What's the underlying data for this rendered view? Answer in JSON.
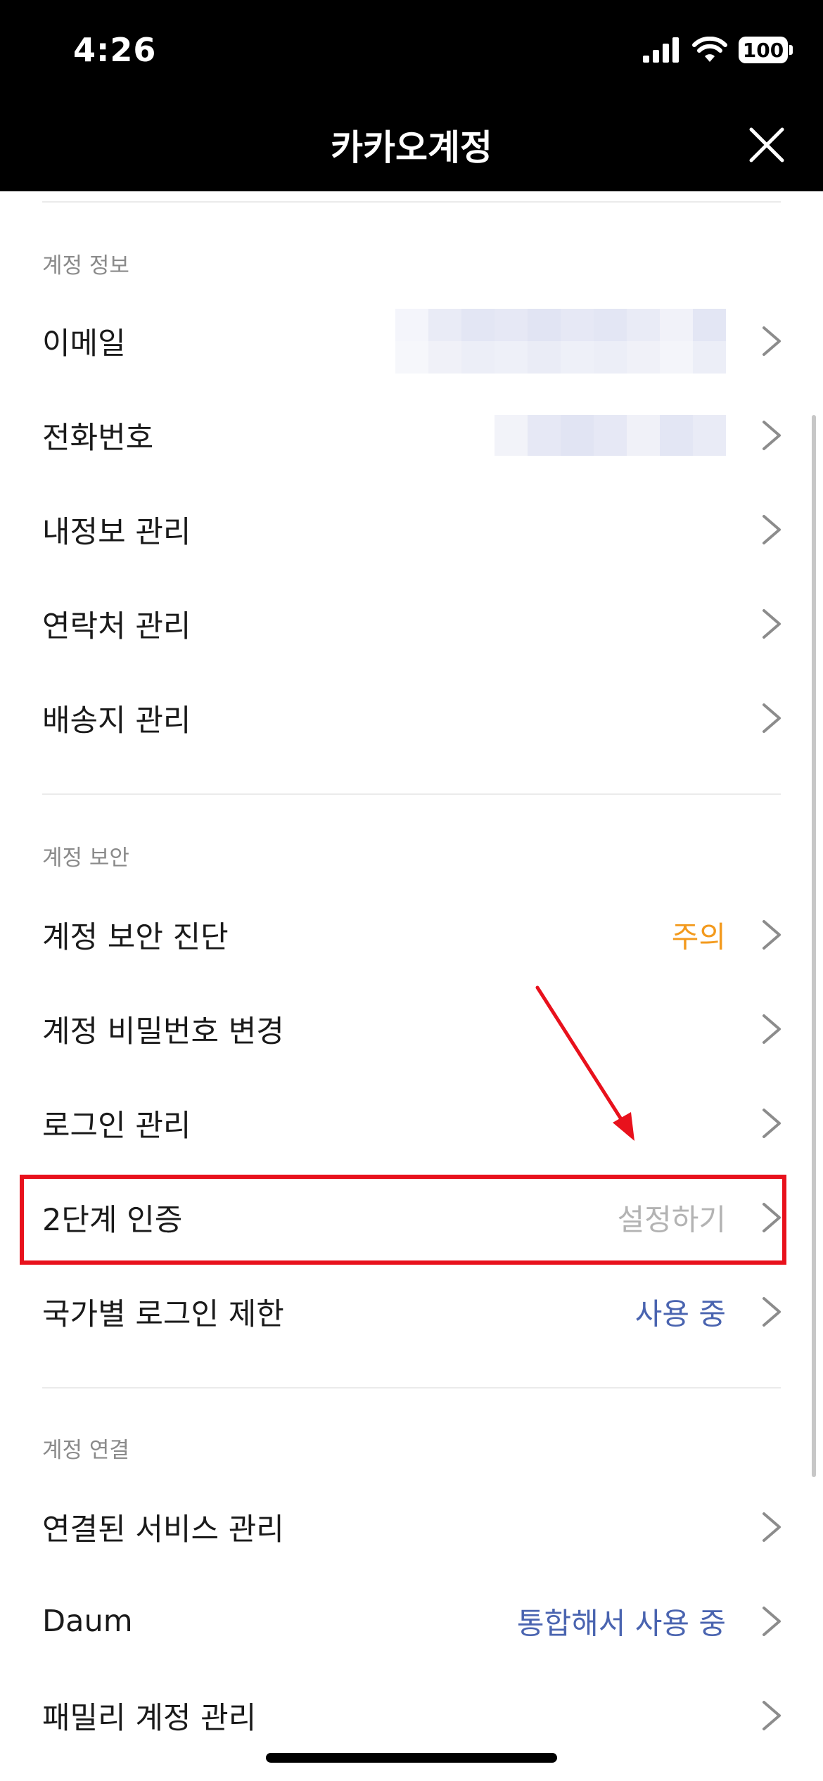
{
  "status_bar": {
    "time": "4:26",
    "battery": "100"
  },
  "header": {
    "title": "카카오계정"
  },
  "sections": [
    {
      "header": "계정 정보",
      "items": [
        {
          "label": "이메일",
          "value": "",
          "value_type": "redacted"
        },
        {
          "label": "전화번호",
          "value": "",
          "value_type": "redacted"
        },
        {
          "label": "내정보 관리",
          "value": ""
        },
        {
          "label": "연락처 관리",
          "value": ""
        },
        {
          "label": "배송지 관리",
          "value": ""
        }
      ]
    },
    {
      "header": "계정 보안",
      "items": [
        {
          "label": "계정 보안 진단",
          "value": "주의",
          "value_color": "#f39a1d"
        },
        {
          "label": "계정 비밀번호 변경",
          "value": ""
        },
        {
          "label": "로그인 관리",
          "value": ""
        },
        {
          "label": "2단계 인증",
          "value": "설정하기",
          "value_color": "#b3b3b3"
        },
        {
          "label": "국가별 로그인 제한",
          "value": "사용 중",
          "value_color": "#4a64b0"
        }
      ]
    },
    {
      "header": "계정 연결",
      "items": [
        {
          "label": "연결된 서비스 관리",
          "value": ""
        },
        {
          "label": "Daum",
          "value": "통합해서 사용 중",
          "value_color": "#4a64b0"
        },
        {
          "label": "패밀리 계정 관리",
          "value": ""
        }
      ]
    }
  ],
  "colors": {
    "highlight_border": "#e8111c",
    "annotation_arrow": "#e8111c"
  }
}
